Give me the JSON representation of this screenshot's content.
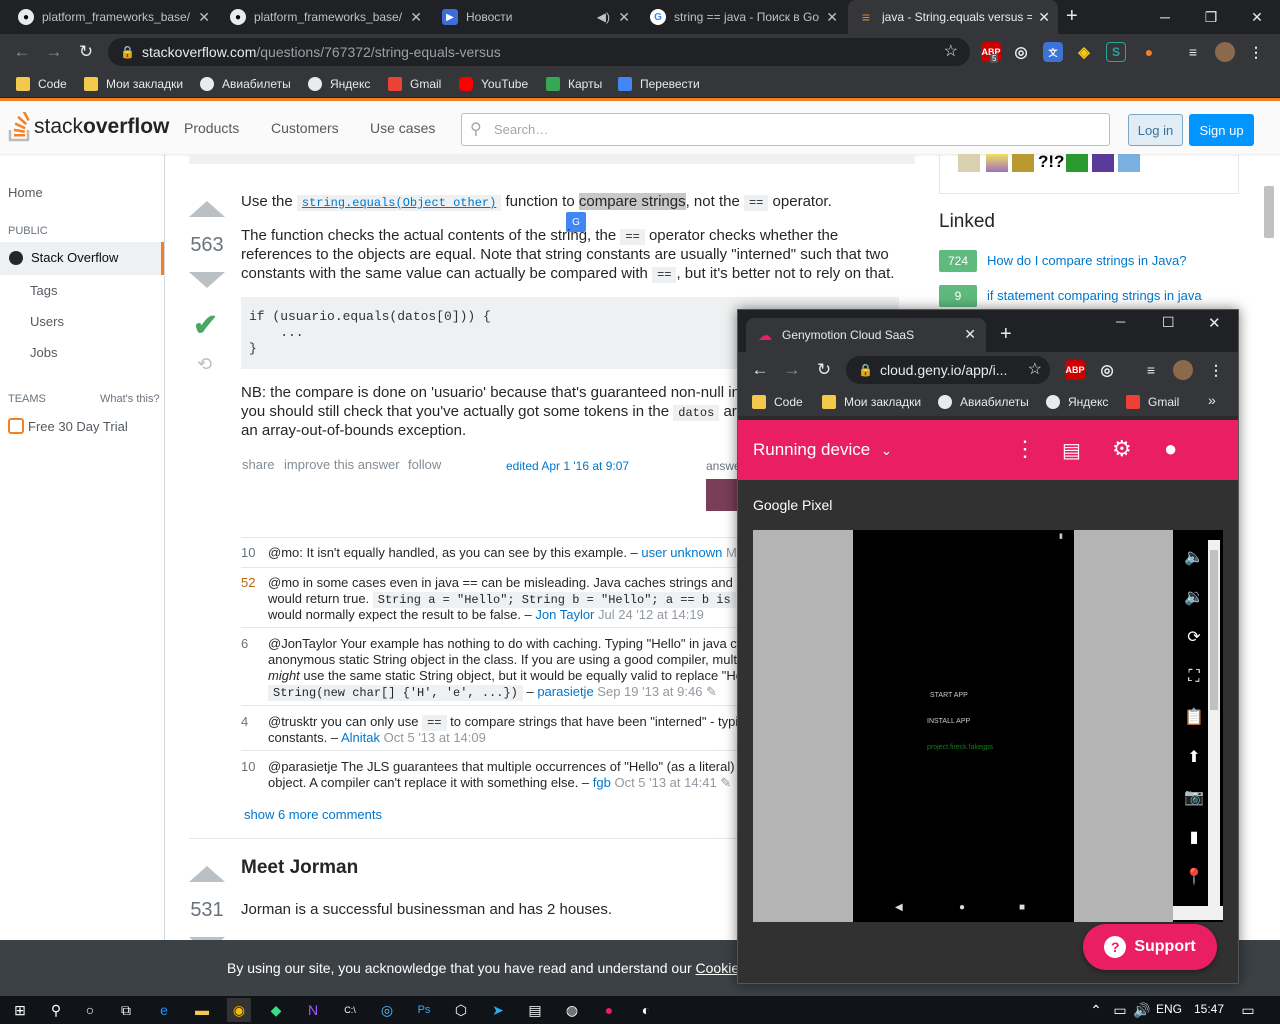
{
  "browser": {
    "tabs": [
      {
        "title": "platform_frameworks_base/",
        "icon": "github-icon"
      },
      {
        "title": "platform_frameworks_base/",
        "icon": "github-icon"
      },
      {
        "title": "Новости",
        "icon": "news-icon"
      },
      {
        "title": "string == java - Поиск в Go",
        "icon": "google-icon"
      },
      {
        "title": "java - String.equals versus ==",
        "icon": "stackoverflow-icon"
      }
    ],
    "url_domain": "stackoverflow.com",
    "url_path": "/questions/767372/string-equals-versus",
    "bookmarks": [
      "Code",
      "Мои закладки",
      "Авиабилеты",
      "Яндекс",
      "Gmail",
      "YouTube",
      "Карты",
      "Перевести"
    ],
    "abp_badge": "5"
  },
  "so_header": {
    "logo_light": "stack",
    "logo_bold": "overflow",
    "nav": [
      "Products",
      "Customers",
      "Use cases"
    ],
    "search_placeholder": "Search…",
    "login": "Log in",
    "signup": "Sign up"
  },
  "left_nav": {
    "home": "Home",
    "public": "PUBLIC",
    "stackoverflow": "Stack Overflow",
    "tags": "Tags",
    "users": "Users",
    "jobs": "Jobs",
    "teams": "TEAMS",
    "whats_this": "What's this?",
    "trial": "Free 30 Day Trial"
  },
  "answer": {
    "votes": "563",
    "p1_a": "Use the ",
    "p1_code": "string.equals(Object other)",
    "p1_b": " function to ",
    "p1_hl": "compare strings",
    "p1_c": ", not the ",
    "p1_op": "==",
    "p1_d": " operator.",
    "p2_l1a": "The function checks the actual contents of the string, the ",
    "p2_l1b": " operator checks whether the",
    "p2_l2": "references to the objects are equal. Note that string constants are usually \"interned\" such that two",
    "p2_l3a": "constants with the same value can actually be compared with ",
    "p2_l3b": ", but it's better not to rely on that.",
    "code": "if (usuario.equals(datos[0])) {\n    ...\n}",
    "nb_l1": "NB: the compare is done on 'usuario' because that's guaranteed non-null in",
    "nb_l2a": "you should still check that you've actually got some tokens in the ",
    "nb_code": "datos",
    "nb_l2b": " ar",
    "nb_l3": "an array-out-of-bounds exception.",
    "menu": [
      "share",
      "improve this answer",
      "follow"
    ],
    "edited": "edited Apr 1 '16 at 9:07",
    "answered": "answe"
  },
  "comments": [
    {
      "score": "10",
      "l1": "@mo: It isn't equally handled, as you can see by this example. – ",
      "user": "user unknown",
      "tail": " M"
    },
    {
      "score": "52",
      "l1": "@mo in some cases even in java == can be misleading. Java caches strings and s",
      "l2a": "would return true. ",
      "l2code": "String a = \"Hello\";  String b = \"Hello\";  a == b is",
      "l3a": "would normally expect the result to be false. – ",
      "user": "Jon Taylor",
      "date": " Jul 24 '12 at 14:19"
    },
    {
      "score": "6",
      "l1": "@JonTaylor Your example has nothing to do with caching. Typing \"Hello\" in java c",
      "l2": "anonymous static String object in the class. If you are using a good compiler, mult",
      "l3a": "might",
      "l3b": " use the same static String object, but it would be equally valid to replace \"He",
      "l4code": "String(new char[] {'H', 'e', ...})",
      "l4a": " – ",
      "user": "parasietje",
      "date": " Sep 19 '13 at 9:46 ✎"
    },
    {
      "score": "4",
      "l1a": "@trusktr you can only use ",
      "l1code": "==",
      "l1b": " to compare strings that have been \"interned\" - typi",
      "l2a": "constants. – ",
      "user": "Alnitak",
      "date": " Oct 5 '13 at 14:09"
    },
    {
      "score": "10",
      "l1": "@parasietje The JLS guarantees that multiple occurrences of \"Hello\" (as a literal)",
      "l2a": "object. A compiler can't replace it with something else. – ",
      "user": "fgb",
      "date": " Oct 5 '13 at 14:41 ✎"
    }
  ],
  "show_more": "show 6 more comments",
  "next_answer": {
    "title": "Meet Jorman",
    "votes": "531",
    "text": "Jorman is a successful businessman and has 2 houses."
  },
  "sidebar": {
    "linked_title": "Linked",
    "linked": [
      {
        "score": "724",
        "text": "How do I compare strings in Java?"
      },
      {
        "score": "9",
        "text": "if statement comparing strings in java"
      }
    ],
    "badge_text": "?!?"
  },
  "cookie": {
    "text": "By using our site, you acknowledge that you have read and understand our ",
    "link": "Cookie Policy"
  },
  "genymotion": {
    "tab_title": "Genymotion Cloud SaaS",
    "url": "cloud.geny.io/app/i...",
    "bookmarks": [
      "Code",
      "Мои закладки",
      "Авиабилеты",
      "Яндекс",
      "Gmail"
    ],
    "appbar_title": "Running device",
    "device_name": "Google Pixel",
    "screen_items": [
      "START APP",
      "INSTALL APP",
      "project.fireck.fakegps"
    ],
    "support": "Support"
  },
  "taskbar": {
    "lang": "ENG",
    "time": "15:47"
  }
}
